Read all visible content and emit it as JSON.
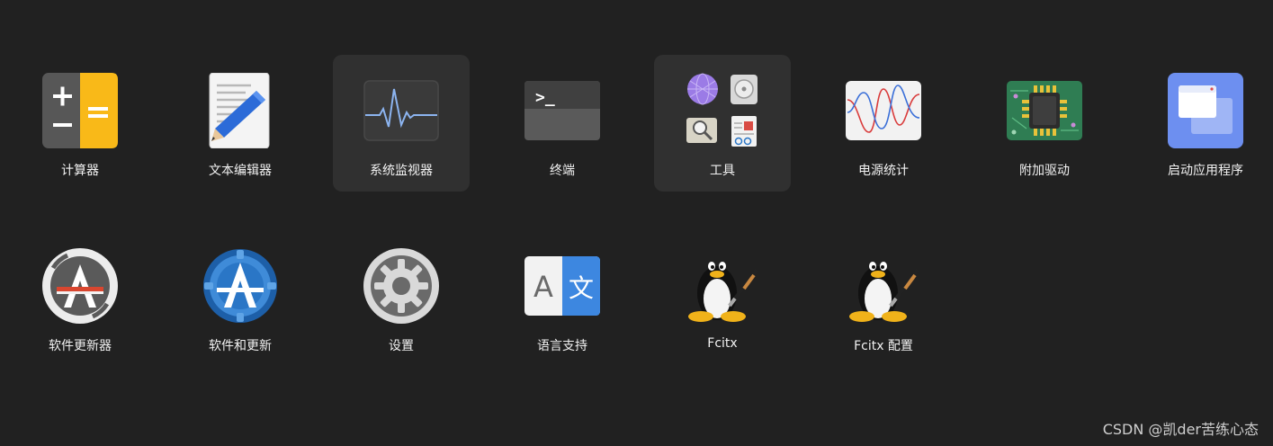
{
  "grid": {
    "row1": [
      {
        "label": "计算器",
        "icon": "calculator-icon"
      },
      {
        "label": "文本编辑器",
        "icon": "text-editor-icon"
      },
      {
        "label": "系统监视器",
        "icon": "system-monitor-icon"
      },
      {
        "label": "终端",
        "icon": "terminal-icon"
      },
      {
        "label": "工具",
        "icon": "tools-folder-icon"
      },
      {
        "label": "电源统计",
        "icon": "power-statistics-icon"
      },
      {
        "label": "附加驱动",
        "icon": "additional-drivers-icon"
      },
      {
        "label": "启动应用程序",
        "icon": "startup-applications-icon"
      }
    ],
    "row2": [
      {
        "label": "软件更新器",
        "icon": "software-updater-icon"
      },
      {
        "label": "软件和更新",
        "icon": "software-sources-icon"
      },
      {
        "label": "设置",
        "icon": "settings-icon"
      },
      {
        "label": "语言支持",
        "icon": "language-support-icon",
        "glyph_a": "A",
        "glyph_b": "文"
      },
      {
        "label": "Fcitx",
        "icon": "fcitx-penguin-icon"
      },
      {
        "label": "Fcitx 配置",
        "icon": "fcitx-config-penguin-icon"
      }
    ]
  },
  "terminal_prompt": ">_",
  "calculator": {
    "plus": "+",
    "minus": "−",
    "equals": "="
  },
  "watermark": "CSDN @凯der苦练心态",
  "colors": {
    "background": "#212121",
    "highlight": "#303030",
    "calculator_yellow": "#f9b918",
    "startup_blue": "#6d8ff0",
    "software_blue": "#2a76c6",
    "language_blue": "#3d87e0"
  }
}
